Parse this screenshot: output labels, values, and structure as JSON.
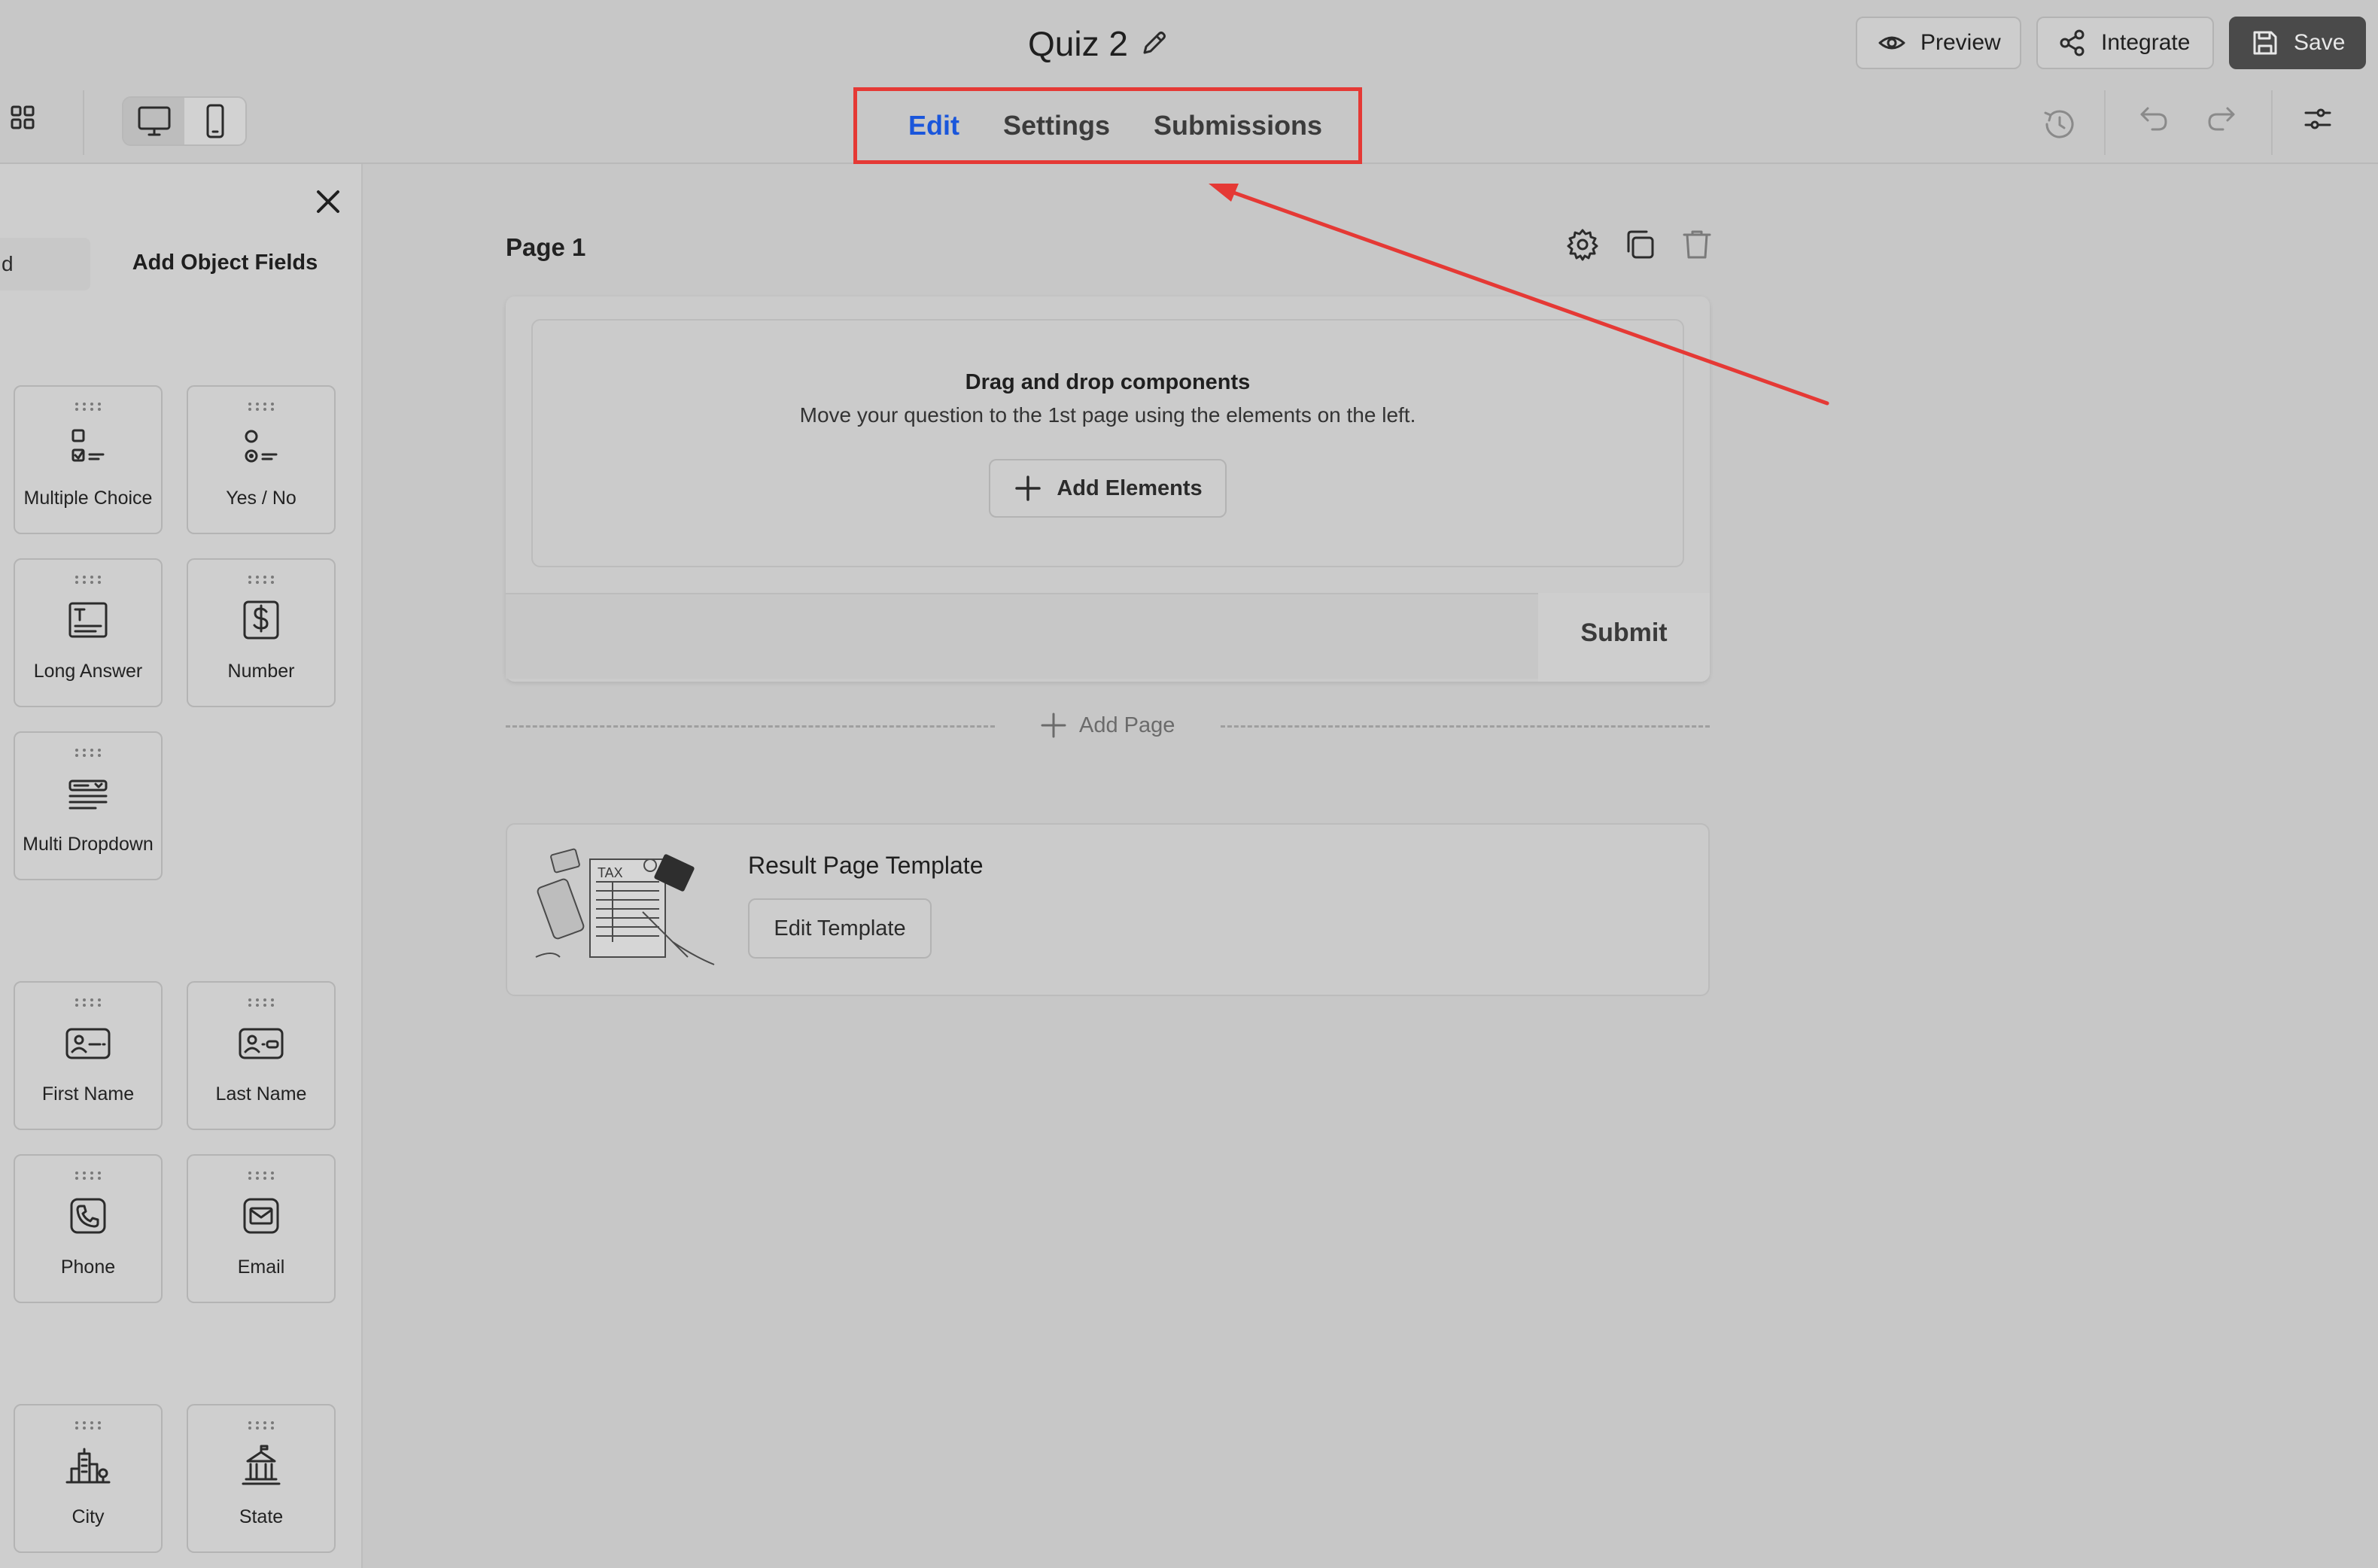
{
  "header": {
    "title": "Quiz 2",
    "preview_label": "Preview",
    "integrate_label": "Integrate",
    "save_label": "Save"
  },
  "tabs": [
    {
      "label": "Edit",
      "active": true
    },
    {
      "label": "Settings",
      "active": false
    },
    {
      "label": "Submissions",
      "active": false
    }
  ],
  "sidebar": {
    "tab_left_label": "d",
    "tab_right_label": "Add Object Fields",
    "tiles": [
      {
        "label": "Multiple Choice",
        "icon": "multiple-choice-icon"
      },
      {
        "label": "Yes / No",
        "icon": "yes-no-icon"
      },
      {
        "label": "Long Answer",
        "icon": "long-answer-icon"
      },
      {
        "label": "Number",
        "icon": "dollar-icon"
      },
      {
        "label": "Multi Dropdown",
        "icon": "multi-dropdown-icon"
      },
      {
        "label": "First Name",
        "icon": "id-card-icon"
      },
      {
        "label": "Last Name",
        "icon": "id-card-icon"
      },
      {
        "label": "Phone",
        "icon": "phone-icon"
      },
      {
        "label": "Email",
        "icon": "email-icon"
      },
      {
        "label": "City",
        "icon": "city-icon"
      },
      {
        "label": "State",
        "icon": "state-building-icon"
      }
    ]
  },
  "page": {
    "title": "Page 1",
    "drop_title": "Drag and drop components",
    "drop_description": "Move your question to the 1st page using the elements on the left.",
    "add_elements_label": "Add Elements",
    "submit_label": "Submit",
    "add_page_label": "Add Page"
  },
  "result": {
    "title": "Result Page Template",
    "edit_label": "Edit Template",
    "illustration_text": "TAX"
  },
  "colors": {
    "active_tab": "#1a56db",
    "highlight_box": "#e53935",
    "annotation_arrow": "#e53935",
    "save_button": "#4a4a4a"
  }
}
